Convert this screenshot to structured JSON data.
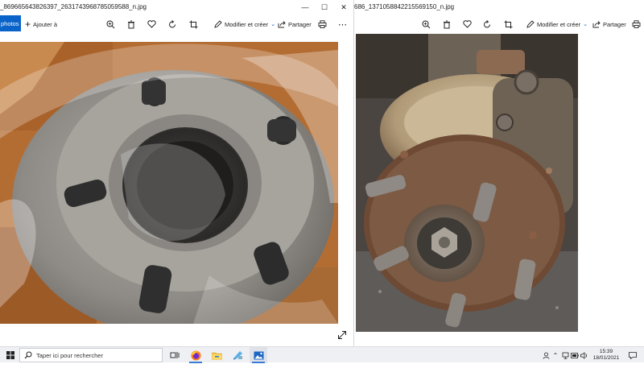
{
  "left_window": {
    "title": "_869665643826397_2631743968785059588_n.jpg",
    "toolbar": {
      "photos_label": "photos",
      "add_label": "Ajouter à",
      "edit_label": "Modifier et créer",
      "share_label": "Partager"
    }
  },
  "right_window": {
    "title": "686_1371058842215569150_n.jpg",
    "toolbar": {
      "edit_label": "Modifier et créer",
      "share_label": "Partager"
    }
  },
  "taskbar": {
    "search_placeholder": "Taper ici pour rechercher",
    "time": "15:39",
    "date": "18/01/2021"
  },
  "colors": {
    "accent": "#0a63c9",
    "taskbar": "#eef0f3"
  }
}
